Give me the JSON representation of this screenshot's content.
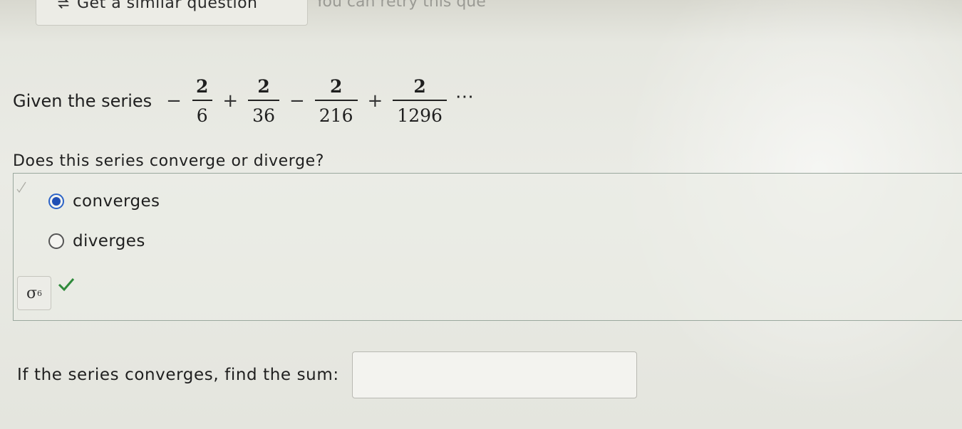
{
  "toolbar": {
    "similar_label": "Get a similar question",
    "retry_text": "You can retry this que"
  },
  "problem": {
    "intro": "Given the series",
    "terms": [
      {
        "sign": "−",
        "numerator": "2",
        "denominator": "6"
      },
      {
        "sign": "+",
        "numerator": "2",
        "denominator": "36"
      },
      {
        "sign": "−",
        "numerator": "2",
        "denominator": "216"
      },
      {
        "sign": "+",
        "numerator": "2",
        "denominator": "1296"
      }
    ],
    "ellipsis": "⋯"
  },
  "question": {
    "text": "Does this series converge or diverge?",
    "options": [
      {
        "label": "converges",
        "selected": true
      },
      {
        "label": "diverges",
        "selected": false
      }
    ],
    "tool_label": "σ",
    "tool_sup": "6",
    "status": "correct"
  },
  "sum": {
    "label": "If the series converges, find the sum:",
    "value": ""
  },
  "colors": {
    "radio_selected": "#1f4fb5",
    "correct_check": "#2f8a3b"
  }
}
